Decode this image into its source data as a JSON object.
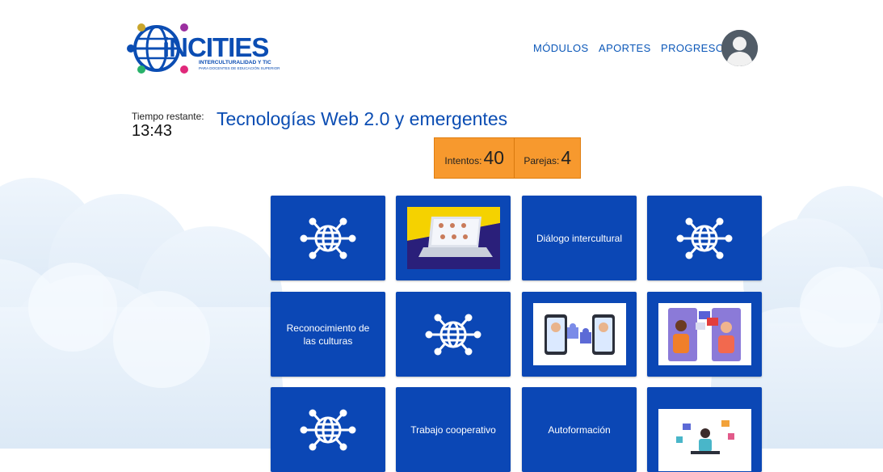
{
  "brand": {
    "name": "iNCITIES",
    "tagline": "INTERCULTURALIDAD Y TIC",
    "subtagline": "PARA DOCENTES DE EDUCACIÓN SUPERIOR"
  },
  "nav": {
    "items": [
      {
        "label": "MÓDULOS"
      },
      {
        "label": "APORTES"
      },
      {
        "label": "PROGRESO"
      }
    ]
  },
  "timer": {
    "label": "Tiempo restante:",
    "value": "13:43"
  },
  "title": "Tecnologías Web 2.0 y emergentes",
  "score": {
    "attempts_label": "Intentos:",
    "attempts": "40",
    "pairs_label": "Parejas:",
    "pairs": "4"
  },
  "cards": [
    {
      "kind": "globe-icon"
    },
    {
      "kind": "laptop-video-call-image"
    },
    {
      "kind": "text",
      "text": "Diálogo intercultural"
    },
    {
      "kind": "globe-icon"
    },
    {
      "kind": "text",
      "text": "Reconocimiento de las culturas"
    },
    {
      "kind": "globe-icon"
    },
    {
      "kind": "puzzle-collaboration-image"
    },
    {
      "kind": "chat-people-image"
    },
    {
      "kind": "globe-icon"
    },
    {
      "kind": "text",
      "text": "Trabajo cooperativo"
    },
    {
      "kind": "text",
      "text": "Autoformación"
    },
    {
      "kind": "self-learning-image"
    }
  ],
  "colors": {
    "brand_blue": "#0b47b5",
    "nav_blue": "#0b57b8",
    "score_orange": "#f7992e",
    "background": "#ffffff"
  }
}
